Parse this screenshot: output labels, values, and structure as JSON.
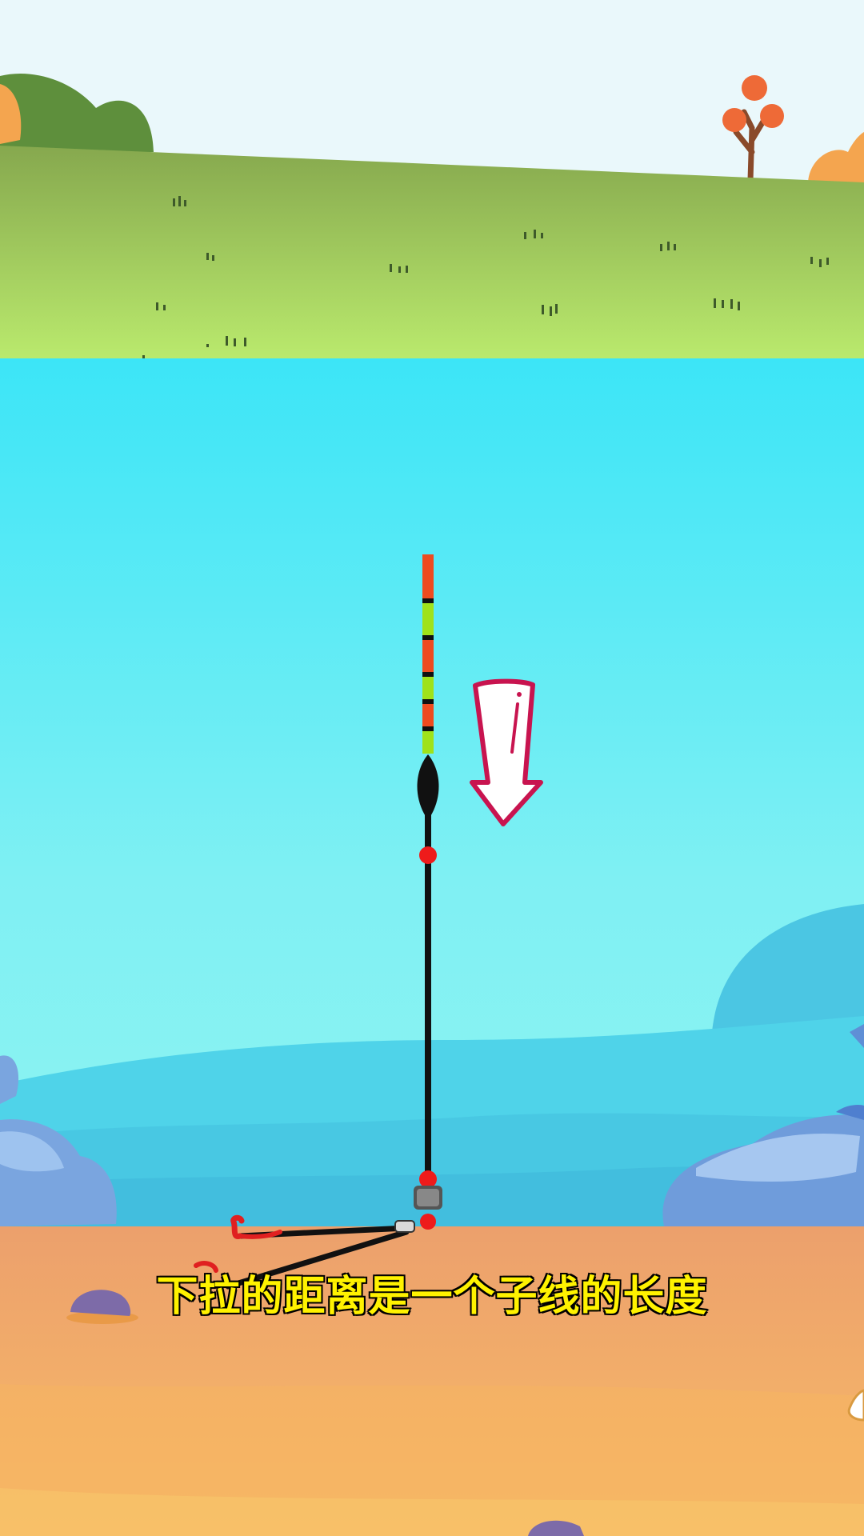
{
  "caption": "下拉的距离是一个子线的长度",
  "colors": {
    "sky": "#eaf8fb",
    "grass_top": "#8fb554",
    "grass_bottom": "#b9ea6c",
    "water_top": "#3de6f7",
    "water_bottom": "#8ef3f3",
    "deep_water": "#4fd2e8",
    "sand_top": "#eda26b",
    "sand_bottom": "#f7b866",
    "rock": "#7aa5df",
    "arrow": "#c8144f",
    "float_red": "#ee4b1f",
    "float_green": "#9fe21a"
  },
  "icons": [
    "down-arrow-icon",
    "fishing-float-icon",
    "fishing-hook-icon"
  ]
}
